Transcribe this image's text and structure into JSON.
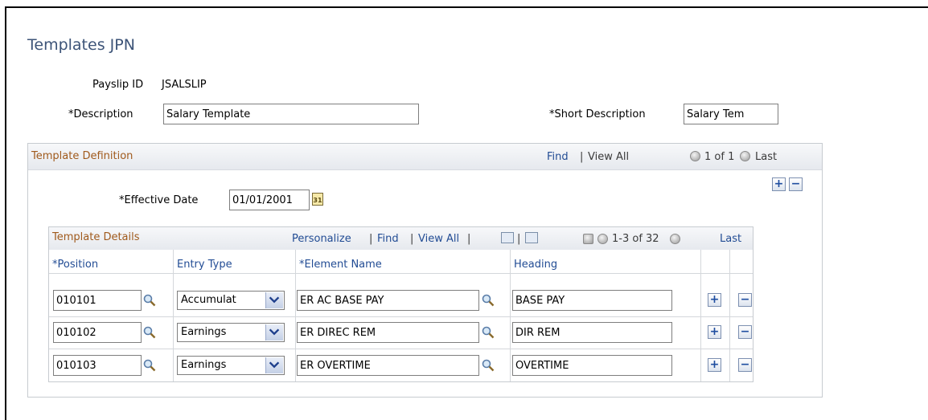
{
  "page": {
    "title": "Templates JPN"
  },
  "header": {
    "payslip_label": "Payslip ID",
    "payslip_value": "JSALSLIP",
    "description_label": "*Description",
    "description_value": "Salary Template",
    "short_description_label": "*Short Description",
    "short_description_value": "Salary Tem"
  },
  "template_definition": {
    "title": "Template Definition",
    "find": "Find",
    "sep": "|",
    "view_all": "View All",
    "count": "1 of 1",
    "last": "Last",
    "effective_date_label": "*Effective Date",
    "effective_date_value": "01/01/2001"
  },
  "template_details": {
    "title": "Template Details",
    "personalize": "Personalize",
    "find": "Find",
    "view_all": "View All",
    "sep": "|",
    "count": "1-3 of 32",
    "last": "Last",
    "columns": [
      "*Position",
      "Entry Type",
      "*Element Name",
      "Heading"
    ],
    "rows": [
      {
        "position": "010101",
        "entry_type": "Accumulat",
        "element_name": "ER AC BASE PAY",
        "heading": "BASE PAY"
      },
      {
        "position": "010102",
        "entry_type": "Earnings",
        "element_name": "ER DIREC REM",
        "heading": "DIR REM"
      },
      {
        "position": "010103",
        "entry_type": "Earnings",
        "element_name": "ER OVERTIME",
        "heading": "OVERTIME"
      }
    ]
  },
  "icons": {
    "add": "+",
    "remove": "−",
    "calendar": "31"
  }
}
